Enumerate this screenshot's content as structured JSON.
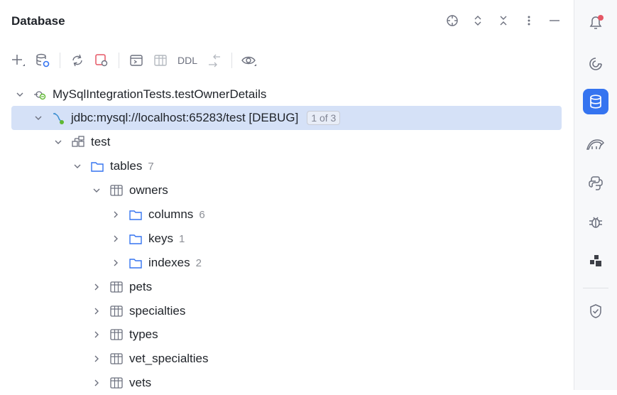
{
  "panel": {
    "title": "Database",
    "header_icons": [
      "crosshair-icon",
      "expand-icon",
      "collapse-icon",
      "more-icon",
      "minimize-icon"
    ]
  },
  "toolbar": {
    "ddl_label": "DDL",
    "icons": [
      "add-icon",
      "datasource-properties-icon",
      "refresh-icon",
      "stop-icon",
      "console-icon",
      "table-icon",
      "ddl",
      "jump-icon",
      "view-icon"
    ]
  },
  "tree": {
    "root": {
      "label": "MySqlIntegrationTests.testOwnerDetails"
    },
    "connection": {
      "label": "jdbc:mysql://localhost:65283/test [DEBUG]",
      "badge": "1 of 3"
    },
    "schema": {
      "label": "test"
    },
    "tables_folder": {
      "label": "tables",
      "count": "7"
    },
    "owners": {
      "label": "owners"
    },
    "owner_children": [
      {
        "label": "columns",
        "count": "6"
      },
      {
        "label": "keys",
        "count": "1"
      },
      {
        "label": "indexes",
        "count": "2"
      }
    ],
    "tables": [
      {
        "label": "pets"
      },
      {
        "label": "specialties"
      },
      {
        "label": "types"
      },
      {
        "label": "vet_specialties"
      },
      {
        "label": "vets"
      }
    ]
  },
  "right_toolbar": {
    "icons": [
      "notifications-icon",
      "ai-assistant-icon",
      "database-icon",
      "gradle-icon",
      "python-icon",
      "debug-icon",
      "plugin-icon",
      "security-icon"
    ],
    "active": "database-icon",
    "accent": "#3574f0",
    "notification_dot": "#e55765"
  }
}
